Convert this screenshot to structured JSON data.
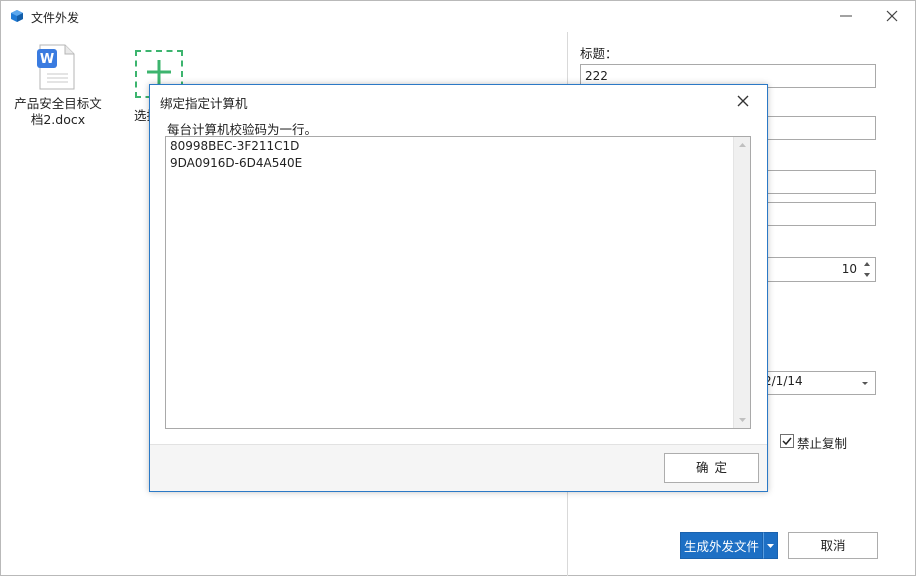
{
  "window": {
    "title": "文件外发"
  },
  "files": [
    {
      "name": "产品安全目标文档2.docx",
      "icon": "word-doc-icon"
    }
  ],
  "add_file": {
    "label": "选择文件"
  },
  "form": {
    "title_label": "标题：",
    "title_value": "222",
    "number_value": "10",
    "date_value": "2/1/14",
    "no_copy_label": "禁止复制",
    "no_copy_checked": true
  },
  "buttons": {
    "generate": "生成外发文件",
    "cancel": "取消"
  },
  "dialog": {
    "title": "绑定指定计算机",
    "hint": "每台计算机校验码为一行。",
    "codes": [
      "80998BEC-3F211C1D",
      "9DA0916D-6D4A540E"
    ],
    "ok": "确定"
  },
  "colors": {
    "accent": "#1d6fc4",
    "add_border": "#3cb46e",
    "dialog_border": "#2b79c6"
  }
}
